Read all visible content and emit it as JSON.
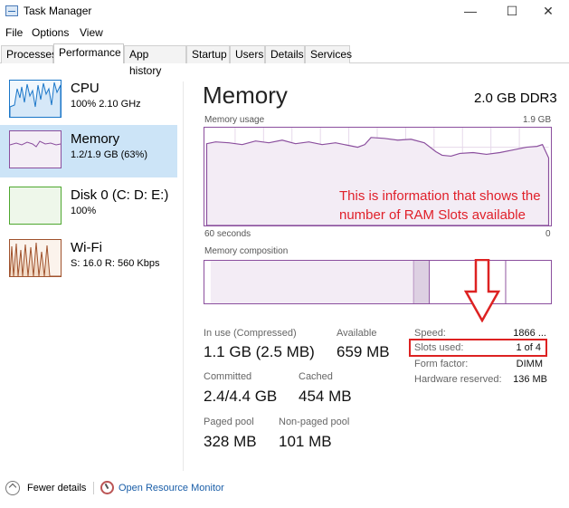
{
  "window": {
    "title": "Task Manager",
    "minimize_glyph": "—",
    "maximize_glyph": "☐",
    "close_glyph": "✕"
  },
  "menu": [
    "File",
    "Options",
    "View"
  ],
  "tabs": [
    "Processes",
    "Performance",
    "App history",
    "Startup",
    "Users",
    "Details",
    "Services"
  ],
  "active_tab": "Performance",
  "sidebar": {
    "items": [
      {
        "title": "CPU",
        "subtitle": "100%  2.10 GHz",
        "color": "#1a76c8"
      },
      {
        "title": "Memory",
        "subtitle": "1.2/1.9 GB (63%)",
        "color": "#8b4f9e"
      },
      {
        "title": "Disk 0 (C: D: E:)",
        "subtitle": "100%",
        "color": "#4ea72e"
      },
      {
        "title": "Wi-Fi",
        "subtitle": "S: 16.0  R: 560 Kbps",
        "color": "#a0522d"
      }
    ]
  },
  "main": {
    "title": "Memory",
    "type": "2.0 GB DDR3",
    "usage_label": "Memory usage",
    "usage_max": "1.9 GB",
    "time_left": "60 seconds",
    "time_right": "0",
    "composition_label": "Memory composition",
    "accent": "#8b4f9e"
  },
  "stats": {
    "in_use_label": "In use (Compressed)",
    "in_use_value": "1.1 GB (2.5 MB)",
    "available_label": "Available",
    "available_value": "659 MB",
    "committed_label": "Committed",
    "committed_value": "2.4/4.4 GB",
    "cached_label": "Cached",
    "cached_value": "454 MB",
    "paged_label": "Paged pool",
    "paged_value": "328 MB",
    "nonpaged_label": "Non-paged pool",
    "nonpaged_value": "101 MB"
  },
  "specs": {
    "speed_label": "Speed:",
    "speed_value": "1866 ...",
    "slots_label": "Slots used:",
    "slots_value": "1 of 4",
    "form_label": "Form factor:",
    "form_value": "DIMM",
    "hw_label": "Hardware reserved:",
    "hw_value": "136 MB"
  },
  "annotation": {
    "text": "This is information that shows the number of RAM Slots available",
    "color": "#e0202a"
  },
  "bottom": {
    "fewer_details": "Fewer details",
    "open_resource_monitor": "Open Resource Monitor"
  }
}
